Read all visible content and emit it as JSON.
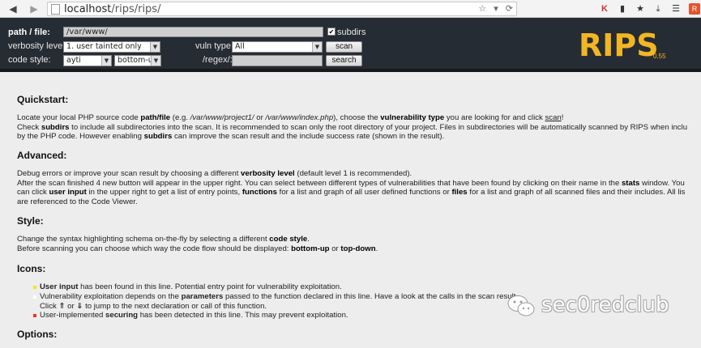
{
  "browser": {
    "back_icon": "back-arrow-icon",
    "forward_icon": "forward-arrow-icon",
    "url_host": "localhost",
    "url_path": "/rips/rips/",
    "url_tools": [
      "☆",
      "▾",
      "⟳"
    ],
    "extension_badge": "R"
  },
  "form": {
    "path_label": "path / file:",
    "path_value": "/var/www/",
    "subdirs_label": "subdirs",
    "subdirs_checked": "✔",
    "verbosity_label": "verbosity level:",
    "verbosity_value": "1. user tainted only",
    "vuln_label": "vuln type:",
    "vuln_value": "All",
    "scan_label": "scan",
    "code_style_label": "code style:",
    "code_style_value": "ayti",
    "flow_value": "bottom-up",
    "regex_label": "/regex/:",
    "regex_value": "",
    "search_label": "search"
  },
  "logo": {
    "text": "RIPS",
    "version": "0.55",
    "color": "#f2b625"
  },
  "content": {
    "quickstart_title": "Quickstart:",
    "advanced_title": "Advanced:",
    "style_title": "Style:",
    "icons_title": "Icons:",
    "options_title": "Options:",
    "icons_list": [
      {
        "color": "#f7e600"
      },
      {
        "color": "#ffffff"
      },
      {
        "color": "#ff2d2d"
      }
    ]
  },
  "watermark": {
    "text": "sec0redclub"
  }
}
